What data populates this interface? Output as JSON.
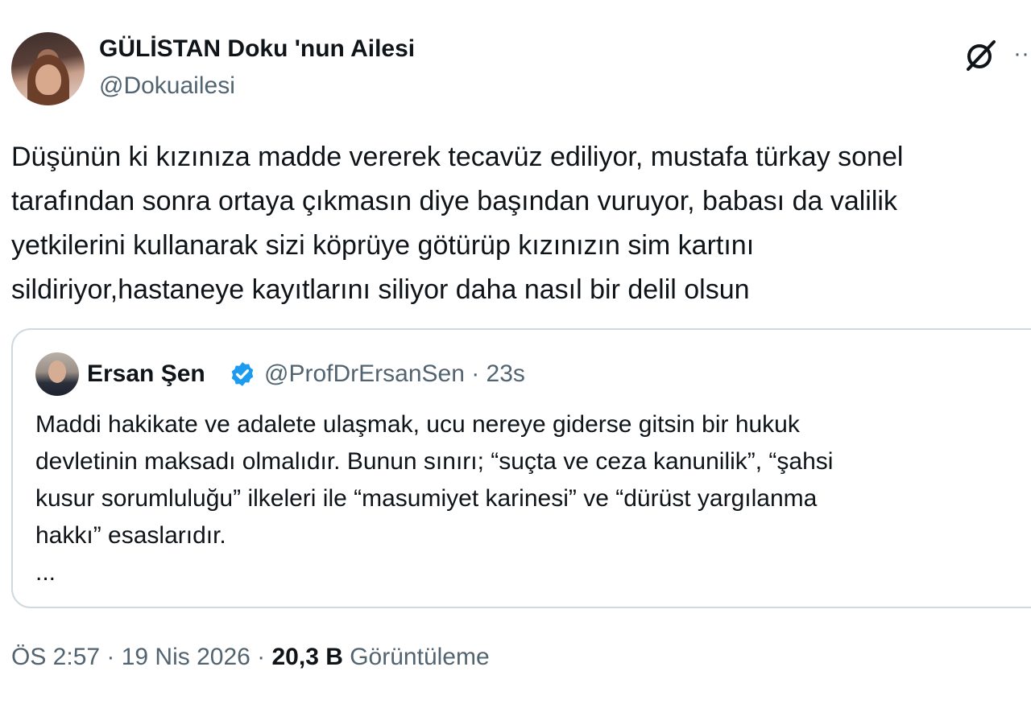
{
  "author": {
    "display_name": "GÜLİSTAN Doku 'nun Ailesi",
    "handle": "@Dokuailesi"
  },
  "header": {
    "grok_icon": "grok-slash-circle-icon",
    "more_icon": "more-dots-icon",
    "more_glyph": "···"
  },
  "tweet": {
    "lines": [
      "Düşünün ki kızınıza madde vererek tecavüz ediliyor, mustafa türkay sonel",
      "tarafından sonra ortaya çıkmasın diye başından vuruyor, babası da valilik",
      "yetkilerini kullanarak sizi köprüye götürüp kızınızın sim kartını",
      "sildiriyor,hastaneye kayıtlarını siliyor daha nasıl bir delil olsun"
    ]
  },
  "quote": {
    "name": "Ersan Şen",
    "verified_icon": "verified-badge-icon",
    "meta": "@ProfDrErsanSen · 23s",
    "lines": [
      "Maddi hakikate ve adalete ulaşmak, ucu nereye giderse gitsin bir hukuk",
      "devletinin maksadı olmalıdır. Bunun sınırı; “suçta ve ceza kanunilik”, “şahsi",
      "kusur sorumluluğu” ilkeleri ile “masumiyet karinesi” ve “dürüst yargılanma",
      "hakkı” esaslarıdır.",
      "..."
    ]
  },
  "footer": {
    "time_date": "ÖS 2:57 · 19 Nis 2026 · ",
    "views_count": "20,3 B",
    "views_label": " Görüntüleme"
  },
  "colors": {
    "text": "#0f1419",
    "secondary": "#536471",
    "border": "#cfd9de",
    "verified": "#1d9bf0"
  }
}
